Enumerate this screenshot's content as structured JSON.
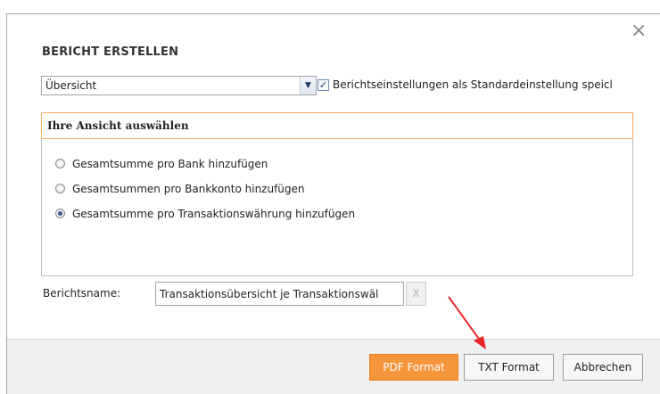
{
  "dialog": {
    "title": "BERICHT ERSTELLEN",
    "close_glyph": "×"
  },
  "report_select": {
    "value": "Übersicht"
  },
  "save_default": {
    "checked": true,
    "label": "Berichtseinstellungen als Standardeinstellung speicl"
  },
  "view": {
    "heading": "Ihre Ansicht auswählen",
    "options": [
      {
        "label": "Gesamtsumme pro Bank hinzufügen",
        "selected": false
      },
      {
        "label": "Gesamtsummen pro Bankkonto hinzufügen",
        "selected": false
      },
      {
        "label": "Gesamtsumme pro Transaktionswährung hinzufügen",
        "selected": true
      }
    ]
  },
  "report_name": {
    "label": "Berichtsname:",
    "value": "Transaktionsübersicht je Transaktionswäl",
    "clear_glyph": "X"
  },
  "buttons": {
    "pdf": "PDF Format",
    "txt": "TXT Format",
    "cancel": "Abbrechen"
  },
  "colors": {
    "accent_orange": "#f7953b",
    "annotation_red": "#e8262a"
  },
  "icons": {
    "close": "close-icon",
    "dropdown": "chevron-down-icon",
    "check": "checkmark-icon",
    "annotation": "red-arrow-annotation"
  }
}
